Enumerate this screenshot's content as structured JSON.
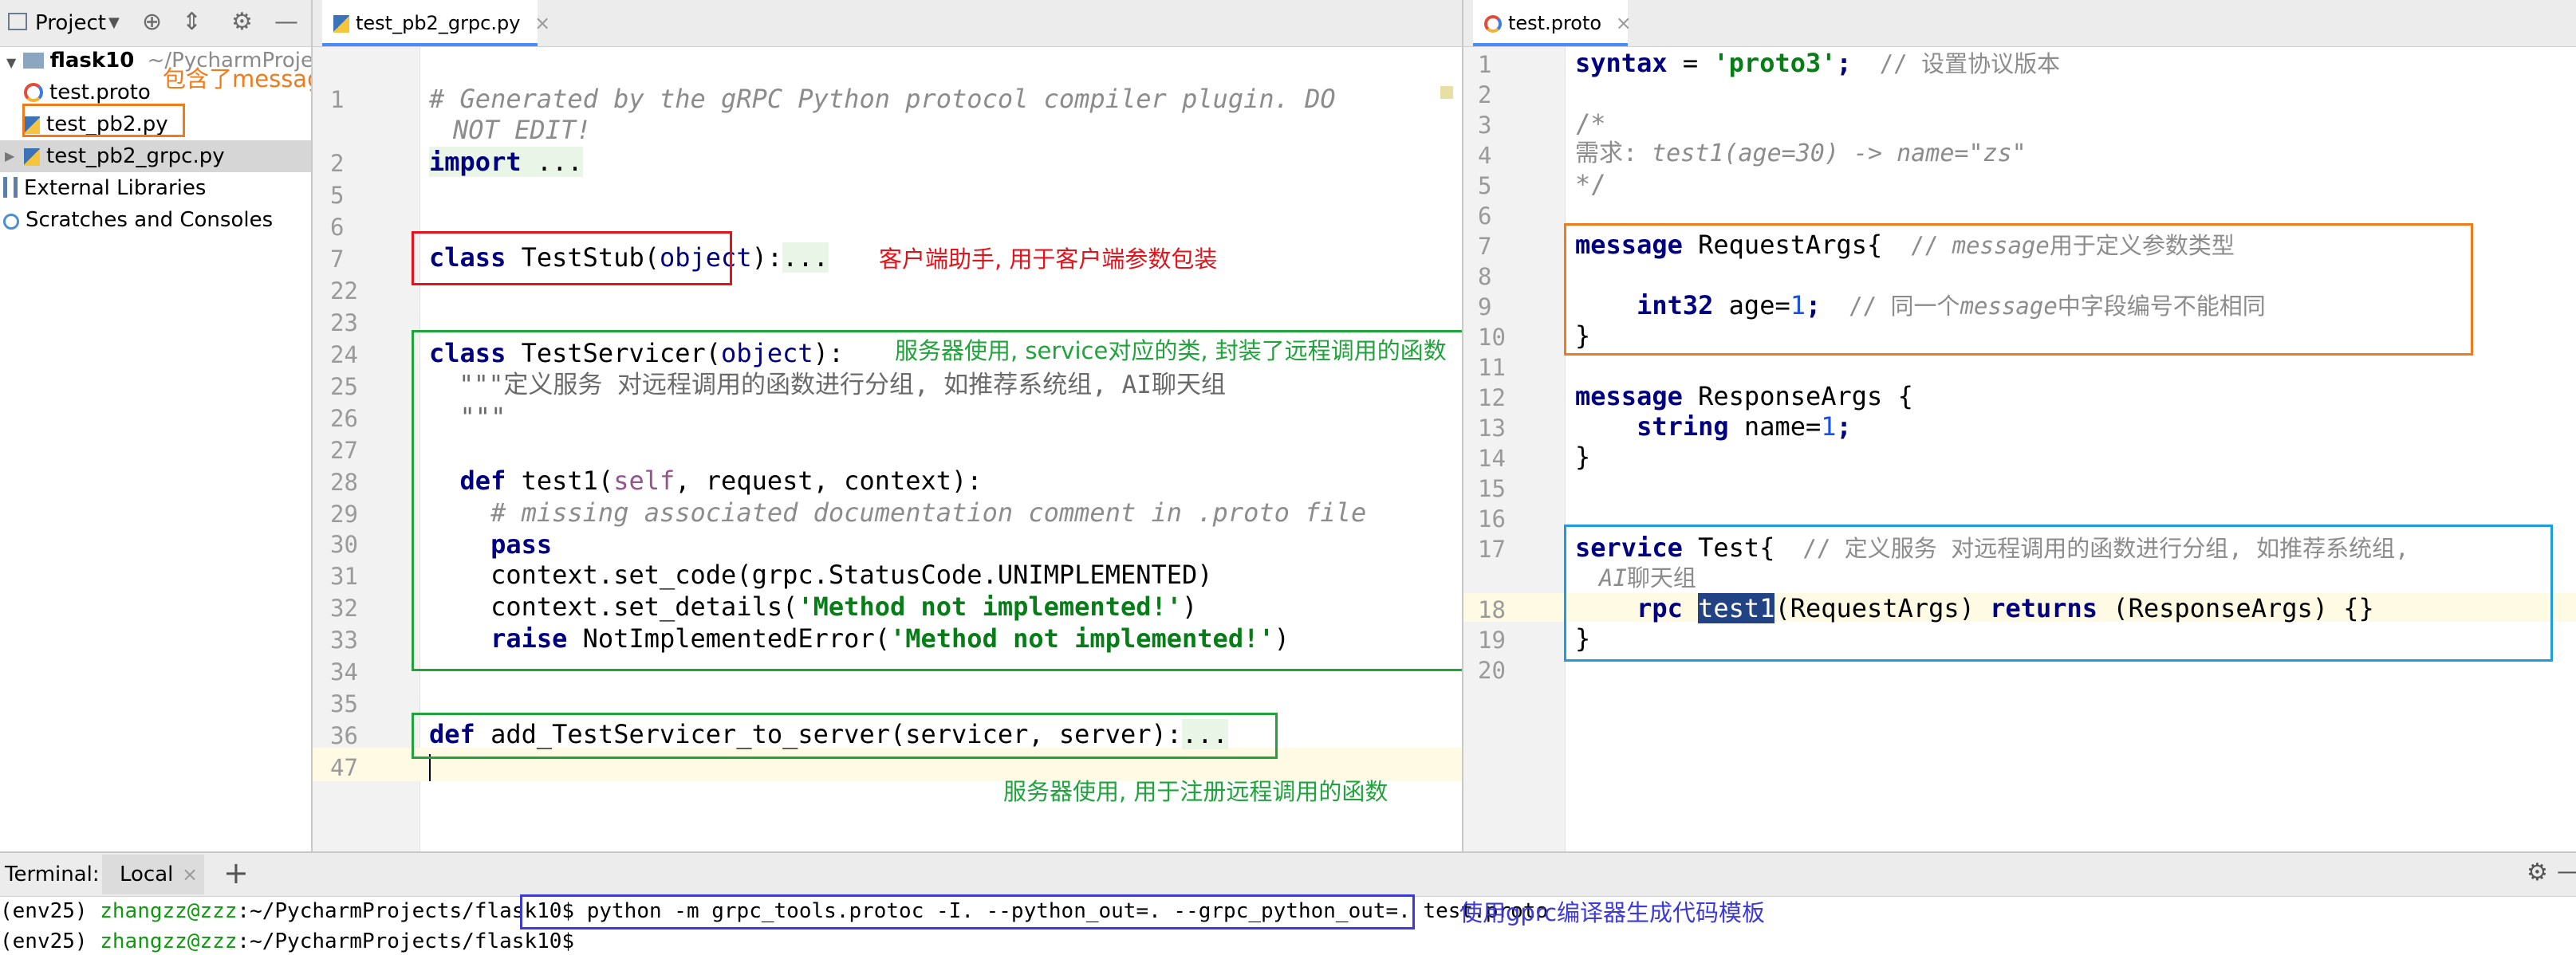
{
  "project_panel": {
    "title": "Project",
    "root_name": "flask10",
    "root_path": "~/PycharmProjects/f",
    "files": [
      "test.proto",
      "test_pb2.py",
      "test_pb2_grpc.py"
    ],
    "external_libraries": "External Libraries",
    "scratches": "Scratches and Consoles",
    "annotation": "包含了message对应的python类"
  },
  "left_editor": {
    "tab_label": "test_pb2_grpc.py",
    "lines": [
      "1",
      "2",
      "5",
      "6",
      "7",
      "22",
      "23",
      "24",
      "25",
      "26",
      "27",
      "28",
      "29",
      "30",
      "31",
      "32",
      "33",
      "34",
      "35",
      "36",
      "47"
    ],
    "code": {
      "l1a": "# Generated by the gRPC Python protocol compiler plugin. DO",
      "l1b": "NOT EDIT!",
      "l2_kw": "import",
      "l2_rest": " ...",
      "l7_kw": "class",
      "l7_name": " TestStub(",
      "l7_obj": "object",
      "l7_end": "):",
      "l7_dots": "...",
      "l24_kw": "class",
      "l24_name": " TestServicer(",
      "l24_obj": "object",
      "l24_end": "):",
      "l25": "  \"\"\"定义服务 对远程调用的函数进行分组, 如推荐系统组, AI聊天组",
      "l26": "  \"\"\"",
      "l28_kw": "  def",
      "l28_name": " test1(",
      "l28_self": "self",
      "l28_rest": ", request, context):",
      "l29": "    # missing associated documentation comment in .proto file",
      "l30": "pass",
      "l31": "    context.set_code(grpc.StatusCode.UNIMPLEMENTED)",
      "l32_a": "    context.set_details(",
      "l32_s": "'Method not implemented!'",
      "l32_b": ")",
      "l33_kw": "raise",
      "l33_a": " NotImplementedError(",
      "l33_s": "'Method not implemented!'",
      "l33_b": ")",
      "l36_kw": "def",
      "l36_name": " add_TestServicer_to_server(servicer, server):",
      "l36_dots": "..."
    },
    "annotations": {
      "stub": "客户端助手, 用于客户端参数包装",
      "servicer": "服务器使用, service对应的类, 封装了远程调用的函数",
      "register": "服务器使用, 用于注册远程调用的函数"
    }
  },
  "right_editor": {
    "tab_label": "test.proto",
    "lines": [
      "1",
      "2",
      "3",
      "4",
      "5",
      "6",
      "7",
      "8",
      "9",
      "10",
      "11",
      "12",
      "13",
      "14",
      "15",
      "16",
      "17",
      "",
      "18",
      "19",
      "20"
    ],
    "code": {
      "l1_kw": "syntax",
      "l1_eq": " = ",
      "l1_str": "'proto3'",
      "l1_semi": ";",
      "l1_cm": "  // 设置协议版本",
      "l3": "/*",
      "l4a": "需求: ",
      "l4b": "test1(age=30) -> name=\"zs\"",
      "l5": "*/",
      "l7_kw": "message",
      "l7_name": " RequestArgs{",
      "l7_cm_a": "  // ",
      "l7_cm_b": "message",
      "l7_cm_c": "用于定义参数类型",
      "l9_kw": "int32",
      "l9_rest": " age=",
      "l9_num": "1",
      "l9_semi": ";",
      "l9_cm_a": "  // 同一个",
      "l9_cm_b": "message",
      "l9_cm_c": "中字段编号不能相同",
      "l10": "}",
      "l12_kw": "message",
      "l12_name": " ResponseArgs {",
      "l13_kw": "string",
      "l13_rest": " name=",
      "l13_num": "1",
      "l13_semi": ";",
      "l14": "}",
      "l17_kw": "service",
      "l17_name": " Test{",
      "l17_cm": "  // 定义服务 对远程调用的函数进行分组, 如推荐系统组,",
      "l17_cm2a": "AI",
      "l17_cm2b": "聊天组",
      "l18_kw": "rpc",
      "l18_sel": "test1",
      "l18_a": "(RequestArgs) ",
      "l18_kw2": "returns",
      "l18_b": " (ResponseArgs) {}",
      "l19": "}"
    }
  },
  "terminal": {
    "label": "Terminal:",
    "tab": "Local",
    "prompt_env": "(env25) ",
    "prompt_user": "zhangzz@zzz",
    "prompt_path": ":~/PycharmProjects/flask10$ ",
    "command": "python -m grpc_tools.protoc -I. --python_out=. --grpc_python_out=. test.proto",
    "annotation": "使用gprc编译器生成代码模板",
    "line2_env": "(env25) ",
    "line2_user": "zhangzz@zzz",
    "line2_path": ":~/PycharmProjects/flask10$"
  },
  "colors": {
    "annot_orange": "#f07b1a",
    "annot_red": "#e4131b",
    "annot_green": "#1fa33a",
    "annot_blue": "#3d3ad6",
    "keyword": "#000080",
    "string": "#067d17",
    "comment": "#8c8c8c"
  }
}
